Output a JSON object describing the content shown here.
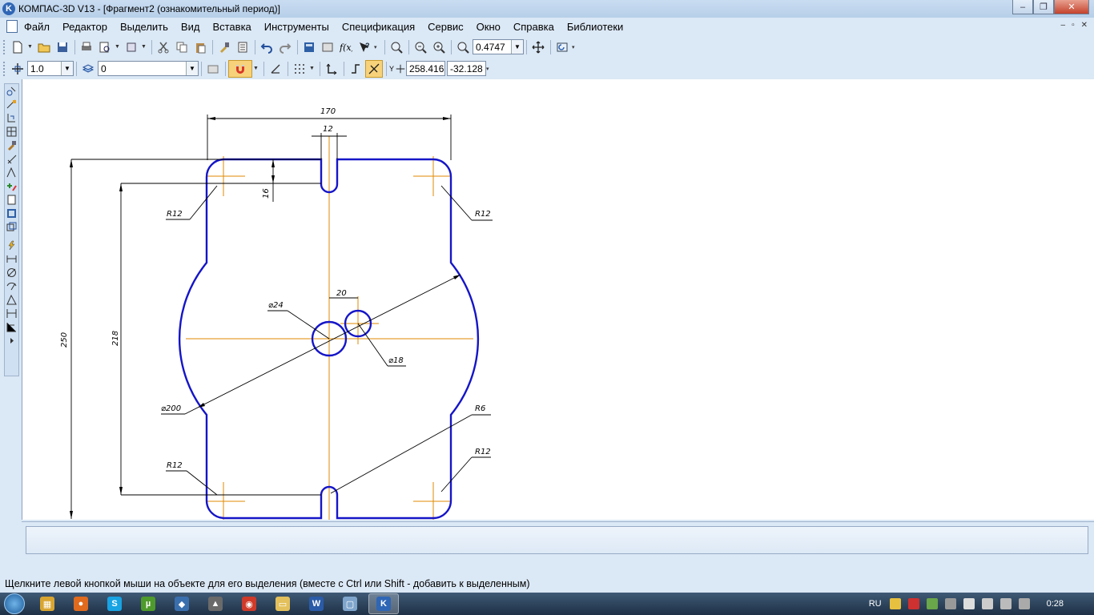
{
  "window": {
    "title": "КОМПАС-3D V13 - [Фрагмент2 (ознакомительный период)]",
    "logo_letter": "K",
    "minimize": "‒",
    "maximize": "❐",
    "close": "✕"
  },
  "menu": {
    "items": [
      "Файл",
      "Редактор",
      "Выделить",
      "Вид",
      "Вставка",
      "Инструменты",
      "Спецификация",
      "Сервис",
      "Окно",
      "Справка",
      "Библиотеки"
    ],
    "doc_controls": [
      "‒",
      "▫",
      "✕"
    ]
  },
  "toolbar1": {
    "zoom_value": "0.4747"
  },
  "toolbar2": {
    "line_step": "1.0",
    "layer": "0",
    "coord_x": "258.416",
    "coord_y": "-32.128",
    "coord_label": "Y"
  },
  "drawing": {
    "dims": {
      "width_total": "170",
      "slot_width": "12",
      "slot_depth": "16",
      "height_total": "250",
      "height_inner": "218",
      "hole_offset": "20"
    },
    "labels": {
      "r12_tl": "R12",
      "r12_tr": "R12",
      "r12_bl": "R12",
      "r12_br": "R12",
      "r6": "R6",
      "d24": "⌀24",
      "d18": "⌀18",
      "d200": "⌀200"
    },
    "colors": {
      "contour": "#1515c8",
      "axis": "#e08a00",
      "dimension": "#000000"
    }
  },
  "status": {
    "hint": "Щелкните левой кнопкой мыши на объекте для его выделения (вместе с Ctrl или Shift - добавить к выделенным)"
  },
  "taskbar": {
    "language": "RU",
    "time": "0:28",
    "apps": [
      {
        "name": "explorer-icon",
        "glyph": "▦",
        "color": "#d8a531"
      },
      {
        "name": "firefox-icon",
        "glyph": "●",
        "color": "#e06a1d"
      },
      {
        "name": "skype-icon",
        "glyph": "S",
        "color": "#18a3e3"
      },
      {
        "name": "utorrent-icon",
        "glyph": "µ",
        "color": "#4f9a2c"
      },
      {
        "name": "shield-app-icon",
        "glyph": "◆",
        "color": "#3a6fae"
      },
      {
        "name": "tanks-icon",
        "glyph": "▲",
        "color": "#6a6a6a"
      },
      {
        "name": "chrome-icon",
        "glyph": "◉",
        "color": "#cf3a2a"
      },
      {
        "name": "folder-icon",
        "glyph": "▭",
        "color": "#e3c05b"
      },
      {
        "name": "word-icon",
        "glyph": "W",
        "color": "#2a5ba8"
      },
      {
        "name": "window-icon",
        "glyph": "▢",
        "color": "#7fa5cc"
      },
      {
        "name": "kompas-icon",
        "glyph": "K",
        "color": "#2f66b5"
      }
    ]
  }
}
